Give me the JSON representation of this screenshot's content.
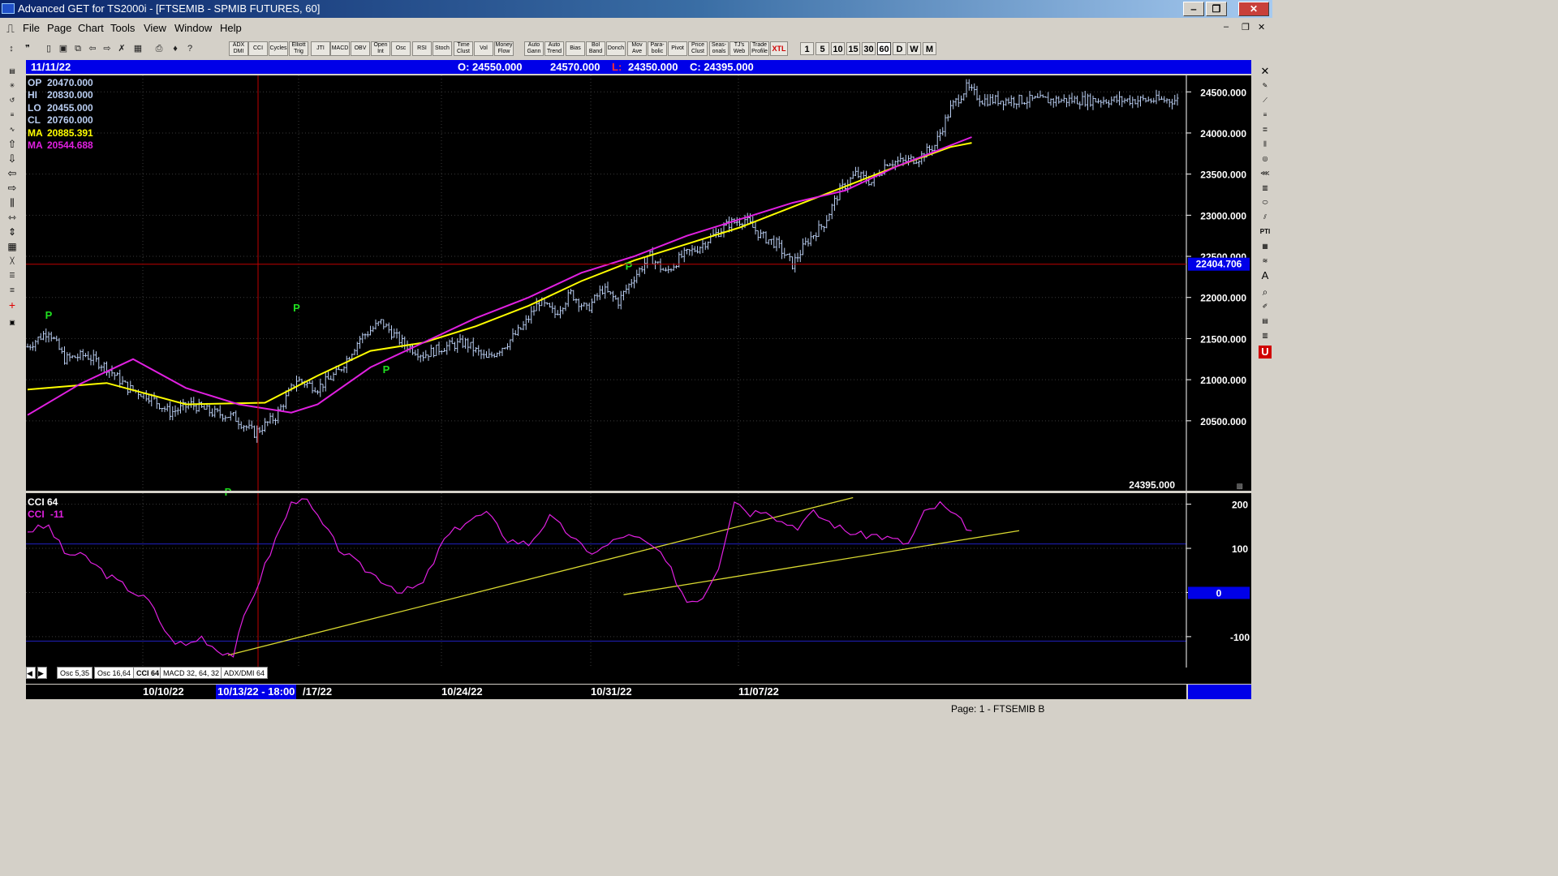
{
  "window": {
    "title": "Advanced GET for TS2000i - [FTSEMIB - SPMIB FUTURES, 60]",
    "min": "‒",
    "max": "❐",
    "close": "✕"
  },
  "menu": [
    "File",
    "Page",
    "Chart",
    "Tools",
    "View",
    "Window",
    "Help"
  ],
  "toolbar": {
    "study_buttons": [
      "ADX DMI",
      "CCI",
      "Cycles",
      "Elliott Trig",
      "JTI",
      "MACD",
      "OBV",
      "Open Int",
      "Osc",
      "RSI",
      "Stoch",
      "Time Clust",
      "Vol",
      "Money Flow",
      "Auto Gann",
      "Auto Trend",
      "Bias",
      "Bol Band",
      "Donch",
      "Mov Ave",
      "Para-bolic",
      "Pivot",
      "Price Clust",
      "Seas-onals",
      "TJ's Web",
      "Trade Profile",
      "XTL"
    ],
    "intervals": [
      "1",
      "5",
      "10",
      "15",
      "30",
      "60",
      "D",
      "W",
      "M"
    ]
  },
  "header_bar": {
    "date": "11/11/22",
    "open": "O: 24550.000",
    "high": "24570.000",
    "low_prefix": "L:",
    "low": "24350.000",
    "close": "C: 24395.000"
  },
  "readouts": {
    "op": {
      "label": "OP",
      "value": "20470.000"
    },
    "hi": {
      "label": "HI",
      "value": "20830.000"
    },
    "lo": {
      "label": "LO",
      "value": "20455.000"
    },
    "cl": {
      "label": "CL",
      "value": "20760.000"
    },
    "ma1": {
      "label": "MA",
      "value": "20885.391"
    },
    "ma2": {
      "label": "MA",
      "value": "20544.688"
    }
  },
  "price_panel": {
    "cursor_price_label": "22404.706",
    "last_price_label": "24395.000"
  },
  "cci_panel": {
    "title": "CCI 64",
    "value_label": "CCI",
    "value": "-11",
    "zero_label": "0"
  },
  "tabs": [
    "Osc 5,35",
    "Osc 16,64",
    "CCI 64",
    "MACD 32, 64, 32",
    "ADX/DMI 64"
  ],
  "date_axis": {
    "labels": [
      "10/10/22",
      "10/13/22 - 18:00",
      "/17/22",
      "10/24/22",
      "10/31/22",
      "11/07/22"
    ]
  },
  "status": "Page: 1 - FTSEMIB B",
  "chart_data": [
    {
      "type": "line",
      "title": "",
      "x_unit": "bar index (60-minute bars)",
      "ylim": [
        19650,
        24680
      ],
      "yticks": [
        20500,
        21000,
        21500,
        22000,
        22500,
        23000,
        23500,
        24000,
        24500
      ],
      "ytick_labels": [
        "20500.000",
        "21000.000",
        "21500.000",
        "22000.000",
        "22500.000",
        "23000.000",
        "23500.000",
        "24000.000",
        "24500.000"
      ],
      "cursor_price": 22404.706,
      "series": [
        {
          "name": "",
          "role": "price",
          "color": "#b8ccf0",
          "x": [
            0,
            8,
            14,
            22,
            30,
            38,
            46,
            54,
            62,
            70,
            78,
            86,
            94,
            102,
            110,
            118,
            126,
            134,
            142,
            150,
            158,
            166,
            174,
            182,
            188,
            194,
            200,
            206,
            212,
            218,
            224,
            230,
            236,
            242,
            248,
            254,
            260,
            266,
            272,
            278,
            284,
            290,
            296,
            302,
            308,
            314,
            320,
            326,
            332,
            338,
            344,
            350,
            356,
            362,
            368,
            374,
            380,
            386,
            392,
            398,
            404,
            410,
            416,
            422,
            428,
            436
          ],
          "y": [
            21400,
            21600,
            21250,
            21300,
            21150,
            20900,
            20800,
            20600,
            20700,
            20600,
            20550,
            20350,
            20550,
            21000,
            20900,
            21100,
            21500,
            21700,
            21450,
            21300,
            21400,
            21450,
            21250,
            21450,
            21650,
            21950,
            21800,
            22050,
            21850,
            22100,
            21950,
            22250,
            22500,
            22300,
            22500,
            22600,
            22750,
            22900,
            22950,
            22750,
            22650,
            22400,
            22700,
            22900,
            23300,
            23500,
            23400,
            23650,
            23650,
            23700,
            23850,
            24300,
            24550,
            24400,
            24400,
            24400,
            24400,
            24400,
            24400,
            24400,
            24400,
            24400,
            24400,
            24400,
            24400,
            24400
          ]
        },
        {
          "name": "MA",
          "role": "ma_fast",
          "color": "#ffff00",
          "x": [
            0,
            30,
            60,
            90,
            110,
            130,
            150,
            170,
            190,
            210,
            230,
            250,
            270,
            290,
            310,
            330,
            350,
            358
          ],
          "y": [
            20880,
            20960,
            20700,
            20720,
            21050,
            21350,
            21450,
            21650,
            21900,
            22200,
            22450,
            22650,
            22850,
            23100,
            23350,
            23600,
            23830,
            23880
          ]
        },
        {
          "name": "MA",
          "role": "ma_slow",
          "color": "#e020e0",
          "x": [
            0,
            20,
            40,
            60,
            80,
            100,
            110,
            130,
            150,
            170,
            190,
            210,
            230,
            250,
            270,
            290,
            310,
            330,
            350,
            358
          ],
          "y": [
            20570,
            20950,
            21250,
            20900,
            20700,
            20600,
            20700,
            21150,
            21450,
            21750,
            22000,
            22300,
            22500,
            22750,
            22950,
            23150,
            23300,
            23600,
            23850,
            23950
          ]
        }
      ],
      "annotations": [
        {
          "label": "P",
          "x": 8,
          "y": 21740,
          "type": "pivot-high"
        },
        {
          "label": "P",
          "x": 102,
          "y": 21830,
          "type": "pivot-high"
        },
        {
          "label": "P",
          "x": 76,
          "y": 19590,
          "type": "pivot-low"
        },
        {
          "label": "P",
          "x": 136,
          "y": 21080,
          "type": "pivot-low"
        },
        {
          "label": "P",
          "x": 228,
          "y": 22340,
          "type": "pivot-low"
        }
      ]
    },
    {
      "type": "line",
      "title": "CCI 64",
      "ylim": [
        -170,
        225
      ],
      "yticks": [
        -100,
        0,
        100,
        200
      ],
      "ytick_labels": [
        "-100",
        "0",
        "100",
        "200"
      ],
      "reference_lines": [
        -110,
        110
      ],
      "series": [
        {
          "name": "CCI",
          "color": "#e020e0",
          "x": [
            0,
            8,
            14,
            22,
            30,
            38,
            46,
            54,
            60,
            66,
            72,
            78,
            82,
            88,
            94,
            100,
            104,
            110,
            118,
            126,
            134,
            142,
            150,
            158,
            166,
            174,
            182,
            190,
            198,
            206,
            212,
            218,
            226,
            232,
            238,
            244,
            250,
            256,
            262,
            268,
            274,
            280,
            286,
            292,
            298,
            304,
            310,
            316,
            322,
            328,
            334,
            340,
            346,
            352,
            358
          ],
          "y": [
            140,
            150,
            90,
            80,
            40,
            10,
            -20,
            -105,
            -120,
            -100,
            -130,
            -140,
            -60,
            30,
            120,
            200,
            220,
            170,
            100,
            60,
            30,
            0,
            20,
            120,
            160,
            180,
            120,
            110,
            170,
            130,
            90,
            100,
            130,
            120,
            100,
            50,
            -20,
            -10,
            60,
            210,
            180,
            190,
            160,
            150,
            180,
            160,
            140,
            130,
            130,
            120,
            110,
            180,
            200,
            170,
            140
          ]
        }
      ],
      "trendlines": [
        {
          "x1": 76,
          "y1": -142,
          "x2": 313,
          "y2": 215,
          "color": "#d8d830"
        },
        {
          "x1": 226,
          "y1": -5,
          "x2": 376,
          "y2": 140,
          "color": "#d8d830"
        }
      ]
    }
  ]
}
